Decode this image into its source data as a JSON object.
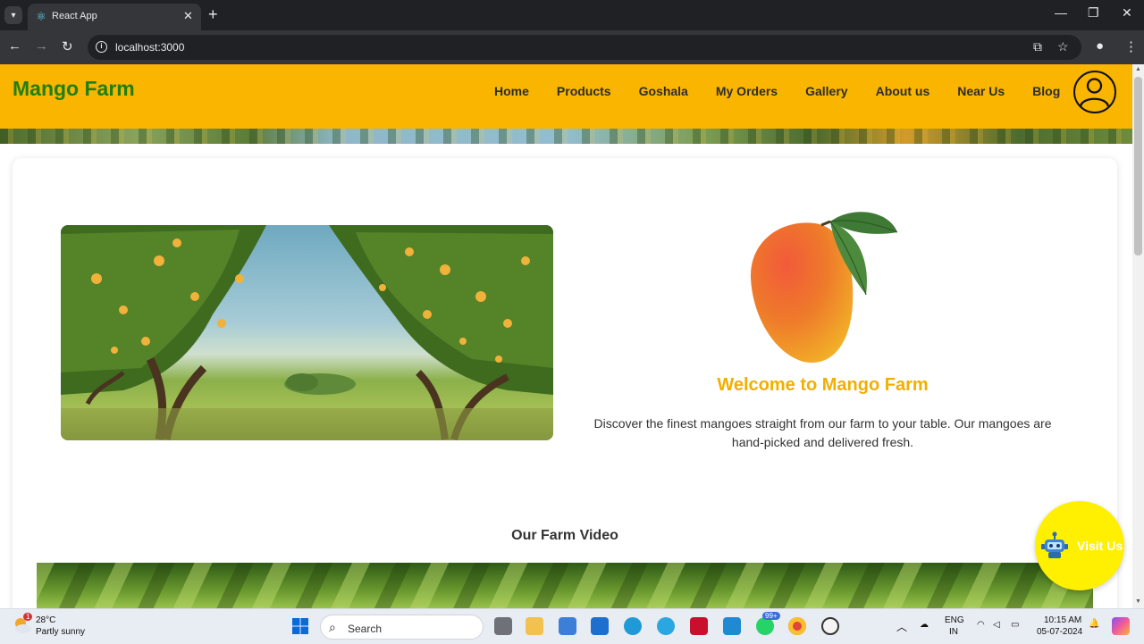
{
  "browser": {
    "tab_title": "React App",
    "url": "localhost:3000"
  },
  "site": {
    "brand": "Mango Farm",
    "nav": [
      "Home",
      "Products",
      "Goshala",
      "My Orders",
      "Gallery",
      "About us",
      "Near Us",
      "Blog"
    ],
    "welcome_title": "Welcome to Mango Farm",
    "welcome_text": "Discover the finest mangoes straight from our farm to your table. Our mangoes are hand-picked and delivered fresh.",
    "video_title": "Our Farm Video",
    "visit_label": "Visit Us",
    "colors": {
      "header_bg": "#f9b500",
      "brand": "#1f7f10",
      "welcome_title": "#f0b000",
      "visit_button": "#ffef00"
    }
  },
  "taskbar": {
    "weather_temp": "28°C",
    "weather_desc": "Partly sunny",
    "weather_badge": "1",
    "search_label": "Search",
    "whatsapp_badge": "99+",
    "lang_top": "ENG",
    "lang_bottom": "IN",
    "time": "10:15 AM",
    "date": "05-07-2024"
  }
}
